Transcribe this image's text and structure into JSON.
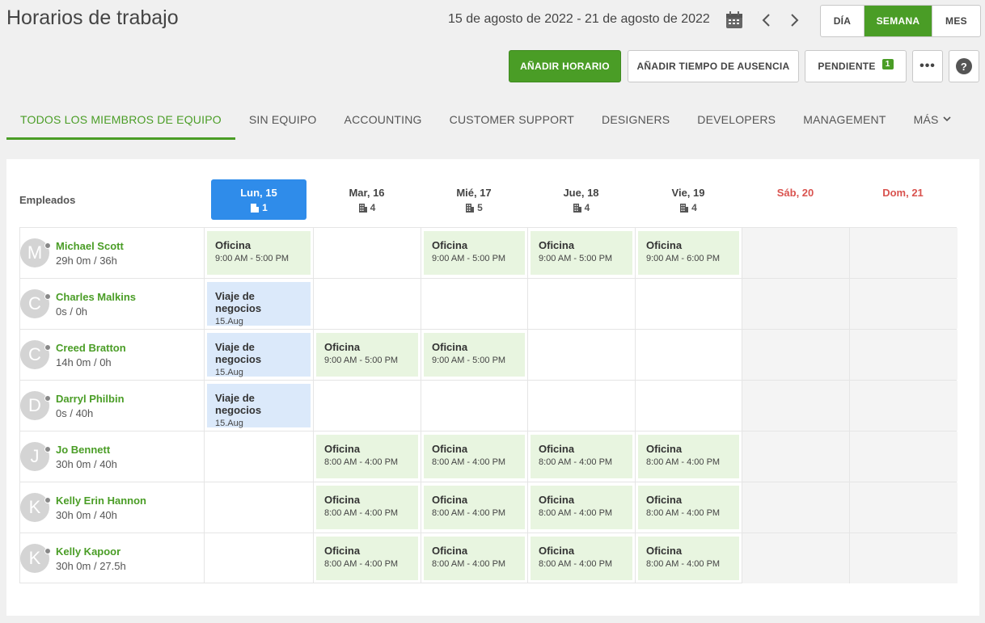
{
  "header": {
    "title": "Horarios de trabajo",
    "date_range": "15 de agosto de 2022 - 21 de agosto de 2022",
    "view_toggle": {
      "day": "DÍA",
      "week": "SEMANA",
      "month": "MES",
      "selected": "SEMANA"
    }
  },
  "toolbar": {
    "add_schedule": "AÑADIR HORARIO",
    "add_absence": "AÑADIR TIEMPO DE AUSENCIA",
    "pending": "PENDIENTE",
    "pending_count": "1",
    "more": "•••",
    "help": "?"
  },
  "tabs": [
    "TODOS LOS MIEMBROS DE EQUIPO",
    "SIN EQUIPO",
    "ACCOUNTING",
    "CUSTOMER SUPPORT",
    "DESIGNERS",
    "DEVELOPERS",
    "MANAGEMENT",
    "MÁS"
  ],
  "schedule": {
    "employees_label": "Empleados",
    "days": [
      {
        "label": "Lun, 15",
        "count": "1"
      },
      {
        "label": "Mar, 16",
        "count": "4"
      },
      {
        "label": "Mié, 17",
        "count": "5"
      },
      {
        "label": "Jue, 18",
        "count": "4"
      },
      {
        "label": "Vie, 19",
        "count": "4"
      },
      {
        "label": "Sáb, 20",
        "count": ""
      },
      {
        "label": "Dom, 21",
        "count": ""
      }
    ],
    "employees": [
      {
        "initial": "M",
        "name": "Michael Scott",
        "hours": "29h 0m / 36h",
        "shifts": [
          {
            "title": "Oficina",
            "detail": "9:00 AM - 5:00 PM",
            "kind": "office"
          },
          null,
          {
            "title": "Oficina",
            "detail": "9:00 AM - 5:00 PM",
            "kind": "office"
          },
          {
            "title": "Oficina",
            "detail": "9:00 AM - 5:00 PM",
            "kind": "office"
          },
          {
            "title": "Oficina",
            "detail": "9:00 AM - 6:00 PM",
            "kind": "office"
          },
          null,
          null
        ]
      },
      {
        "initial": "C",
        "name": "Charles Malkins",
        "hours": "0s / 0h",
        "shifts": [
          {
            "title": "Viaje de negocios",
            "detail": "15.Aug",
            "kind": "trip"
          },
          null,
          null,
          null,
          null,
          null,
          null
        ]
      },
      {
        "initial": "C",
        "name": "Creed Bratton",
        "hours": "14h 0m / 0h",
        "shifts": [
          {
            "title": "Viaje de negocios",
            "detail": "15.Aug",
            "kind": "trip"
          },
          {
            "title": "Oficina",
            "detail": "9:00 AM - 5:00 PM",
            "kind": "office"
          },
          {
            "title": "Oficina",
            "detail": "9:00 AM - 5:00 PM",
            "kind": "office"
          },
          null,
          null,
          null,
          null
        ]
      },
      {
        "initial": "D",
        "name": "Darryl Philbin",
        "hours": "0s / 40h",
        "shifts": [
          {
            "title": "Viaje de negocios",
            "detail": "15.Aug",
            "kind": "trip"
          },
          null,
          null,
          null,
          null,
          null,
          null
        ]
      },
      {
        "initial": "J",
        "name": "Jo Bennett",
        "hours": "30h 0m / 40h",
        "shifts": [
          null,
          {
            "title": "Oficina",
            "detail": "8:00 AM - 4:00 PM",
            "kind": "office"
          },
          {
            "title": "Oficina",
            "detail": "8:00 AM - 4:00 PM",
            "kind": "office"
          },
          {
            "title": "Oficina",
            "detail": "8:00 AM - 4:00 PM",
            "kind": "office"
          },
          {
            "title": "Oficina",
            "detail": "8:00 AM - 4:00 PM",
            "kind": "office"
          },
          null,
          null
        ]
      },
      {
        "initial": "K",
        "name": "Kelly Erin Hannon",
        "hours": "30h 0m / 40h",
        "shifts": [
          null,
          {
            "title": "Oficina",
            "detail": "8:00 AM - 4:00 PM",
            "kind": "office"
          },
          {
            "title": "Oficina",
            "detail": "8:00 AM - 4:00 PM",
            "kind": "office"
          },
          {
            "title": "Oficina",
            "detail": "8:00 AM - 4:00 PM",
            "kind": "office"
          },
          {
            "title": "Oficina",
            "detail": "8:00 AM - 4:00 PM",
            "kind": "office"
          },
          null,
          null
        ]
      },
      {
        "initial": "K",
        "name": "Kelly Kapoor",
        "hours": "30h 0m / 27.5h",
        "shifts": [
          null,
          {
            "title": "Oficina",
            "detail": "8:00 AM - 4:00 PM",
            "kind": "office"
          },
          {
            "title": "Oficina",
            "detail": "8:00 AM - 4:00 PM",
            "kind": "office"
          },
          {
            "title": "Oficina",
            "detail": "8:00 AM - 4:00 PM",
            "kind": "office"
          },
          {
            "title": "Oficina",
            "detail": "8:00 AM - 4:00 PM",
            "kind": "office"
          },
          null,
          null
        ]
      }
    ]
  },
  "colors": {
    "accent": "#4a9d26",
    "today": "#2f8cea",
    "weekend_text": "#d9534f",
    "office_bg": "#e8f5e0",
    "trip_bg": "#dbe9fa"
  }
}
